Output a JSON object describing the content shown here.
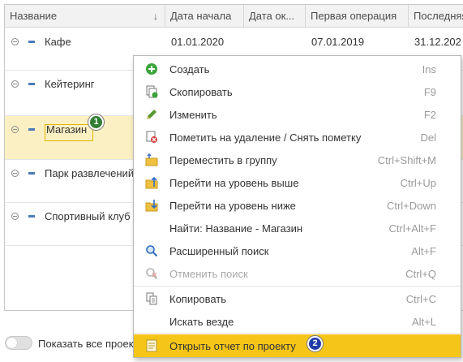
{
  "grid": {
    "columns": [
      "Название",
      "Дата начала",
      "Дата ок...",
      "Первая операция",
      "Последняя"
    ],
    "sort_indicator": "↓",
    "rows": [
      {
        "name": "Кафе",
        "start_date": "01.01.2020",
        "end_date": "",
        "first_operation": "07.01.2019",
        "last_operation": "31.12.202"
      },
      {
        "name": "Кейтеринг"
      },
      {
        "name": "Магазин"
      },
      {
        "name": "Парк развлечений"
      },
      {
        "name": "Спортивный клуб"
      }
    ]
  },
  "badges": {
    "first": "1",
    "second": "2"
  },
  "context_menu": {
    "items": [
      {
        "label": "Создать",
        "shortcut": "Ins",
        "icon": "add-icon"
      },
      {
        "label": "Скопировать",
        "shortcut": "F9",
        "icon": "copy-add-icon"
      },
      {
        "label": "Изменить",
        "shortcut": "F2",
        "icon": "pencil-icon"
      },
      {
        "label": "Пометить на удаление / Снять пометку",
        "shortcut": "Del",
        "icon": "delete-mark-icon"
      },
      {
        "label": "Переместить в группу",
        "shortcut": "Ctrl+Shift+M",
        "icon": "move-to-group-icon"
      },
      {
        "label": "Перейти на уровень выше",
        "shortcut": "Ctrl+Up",
        "icon": "level-up-icon"
      },
      {
        "label": "Перейти на уровень ниже",
        "shortcut": "Ctrl+Down",
        "icon": "level-down-icon"
      },
      {
        "label": "Найти: Название - Магазин",
        "shortcut": "Ctrl+Alt+F",
        "icon": ""
      },
      {
        "label": "Расширенный поиск",
        "shortcut": "Alt+F",
        "icon": "search-icon"
      },
      {
        "label": "Отменить поиск",
        "shortcut": "Ctrl+Q",
        "icon": "cancel-search-icon",
        "disabled": true
      },
      {
        "label": "Копировать",
        "shortcut": "Ctrl+C",
        "icon": "copy-icon"
      },
      {
        "label": "Искать везде",
        "shortcut": "Alt+L",
        "icon": ""
      },
      {
        "label": "Открыть отчет по проекту",
        "shortcut": "",
        "icon": "report-icon",
        "highlighted": true
      }
    ]
  },
  "footer": {
    "toggle_label": "Показать все проек"
  },
  "colors": {
    "highlight": "#f5c518",
    "selected_row": "#fbf0c3",
    "badge_green": "#2f7d32",
    "badge_blue": "#1f3aa8"
  }
}
